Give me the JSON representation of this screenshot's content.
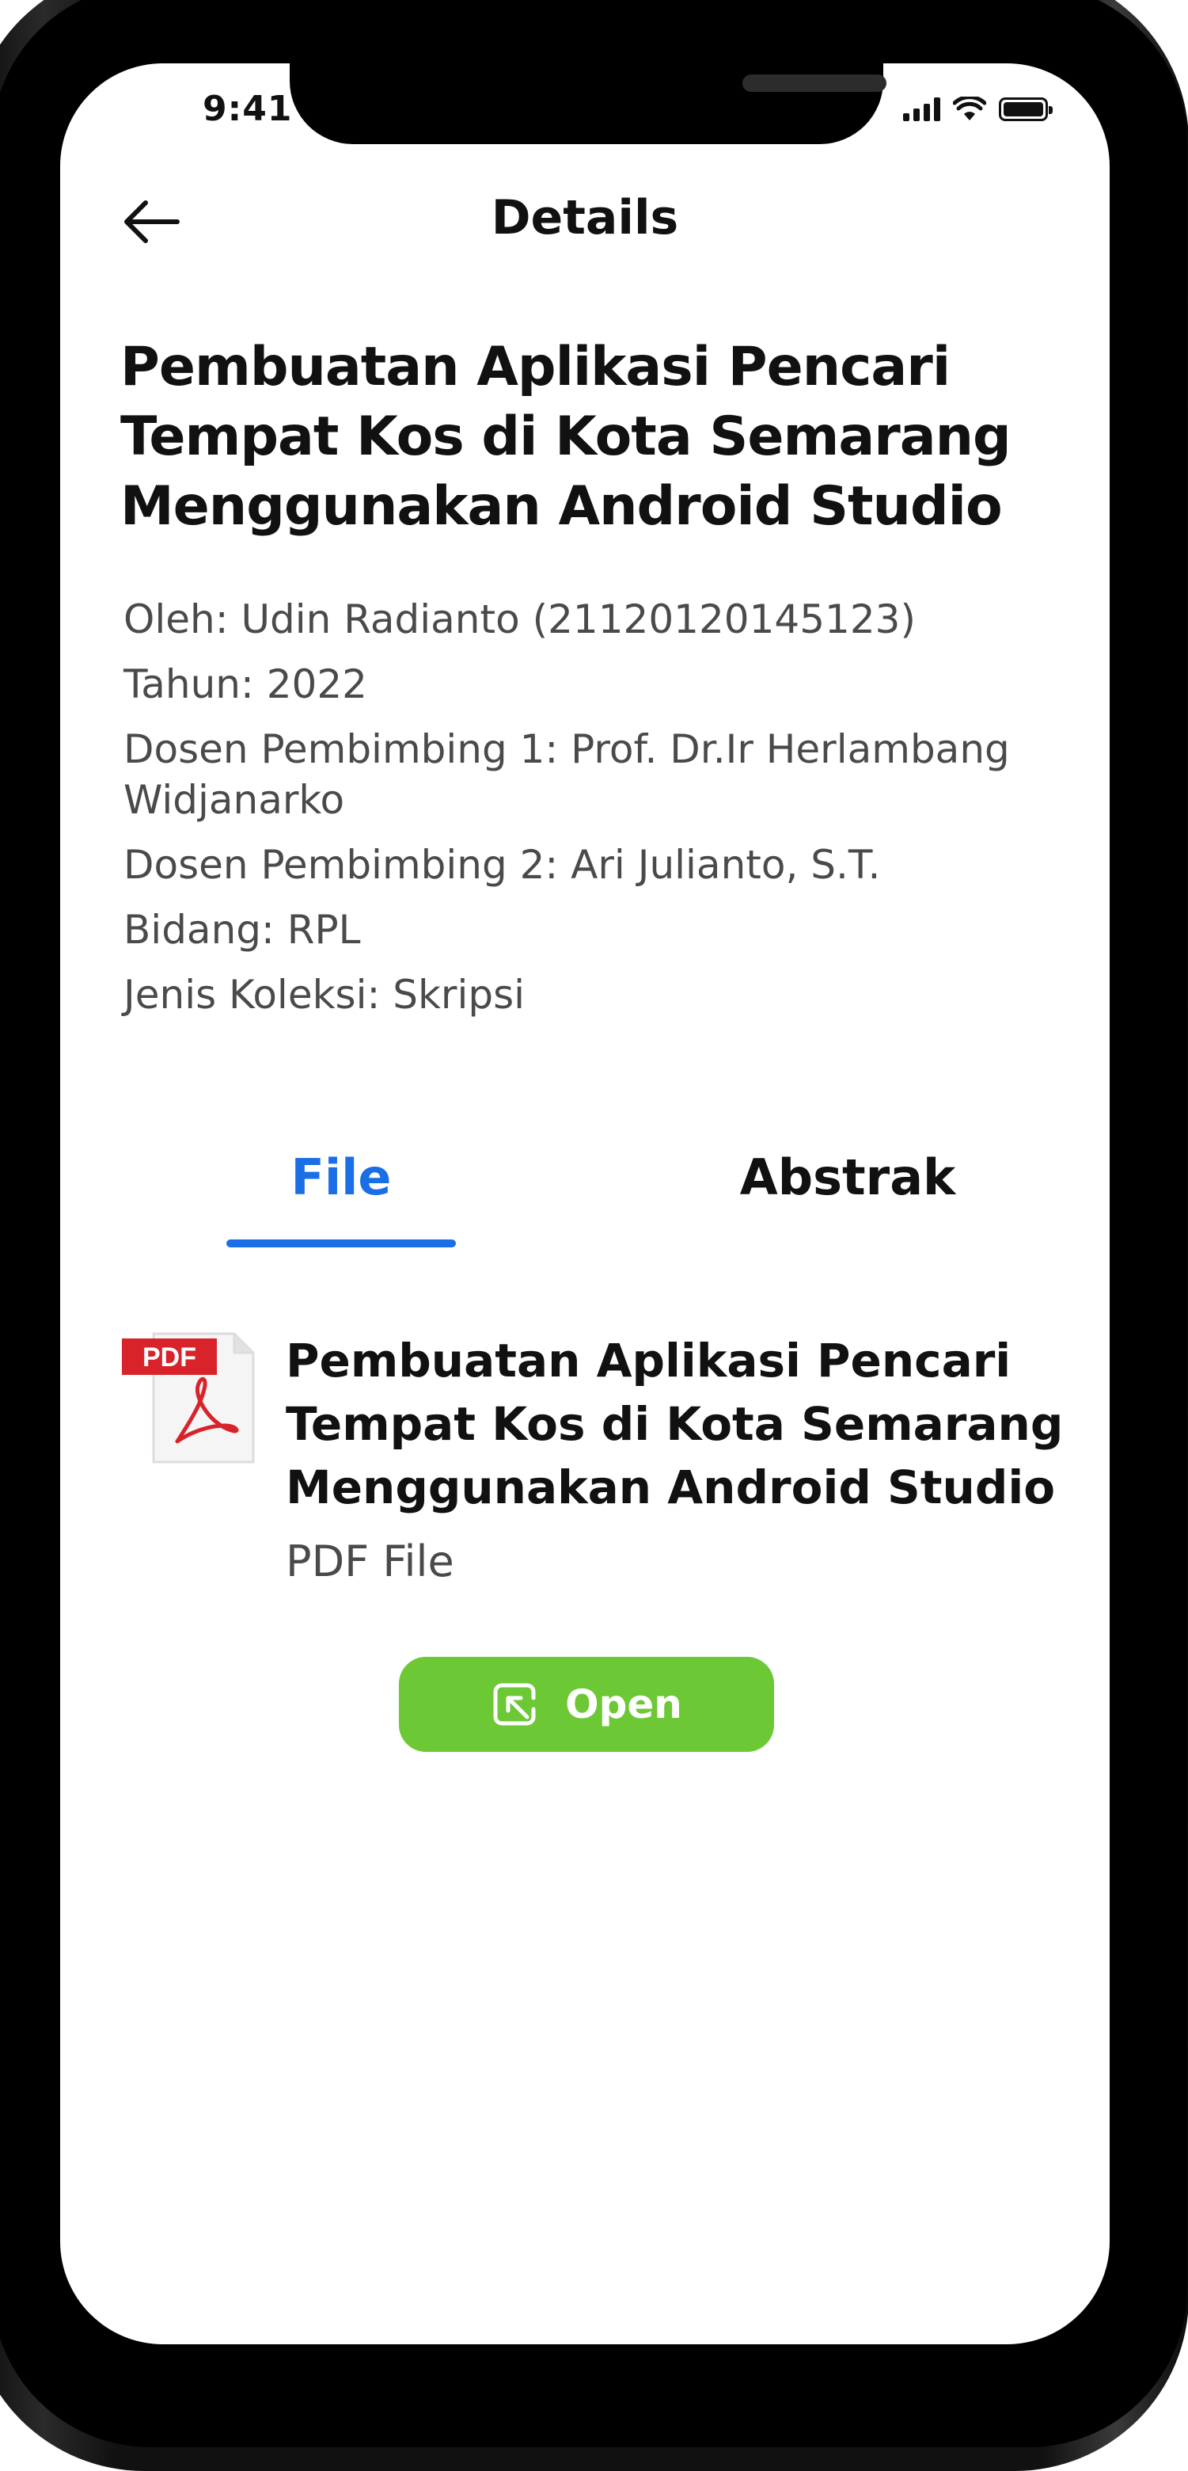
{
  "status_bar": {
    "time": "9:41"
  },
  "header": {
    "title": "Details",
    "back_icon": "arrow-left-icon"
  },
  "document": {
    "title": "Pembuatan Aplikasi Pencari Tempat Kos di Kota Semarang Menggunakan Android Studio",
    "meta": {
      "author": "Oleh: Udin Radianto (21120120145123)",
      "year": "Tahun: 2022",
      "supervisor1": "Dosen Pembimbing 1:  Prof. Dr.Ir Herlambang Widjanarko",
      "supervisor2": "Dosen Pembimbing 2: Ari Julianto, S.T.",
      "field": "Bidang: RPL",
      "collection": "Jenis Koleksi: Skripsi"
    }
  },
  "tabs": {
    "items": [
      "File",
      "Abstrak"
    ],
    "active": "File",
    "active_color": "#1a6ee6"
  },
  "file": {
    "icon": "pdf-file-icon",
    "icon_label": "PDF",
    "title": "Pembuatan Aplikasi Pencari Tempat Kos di Kota Semarang Menggunakan Android Studio",
    "type": "PDF File"
  },
  "open_button": {
    "label": "Open",
    "icon": "open-external-icon",
    "color": "#6cc834"
  }
}
